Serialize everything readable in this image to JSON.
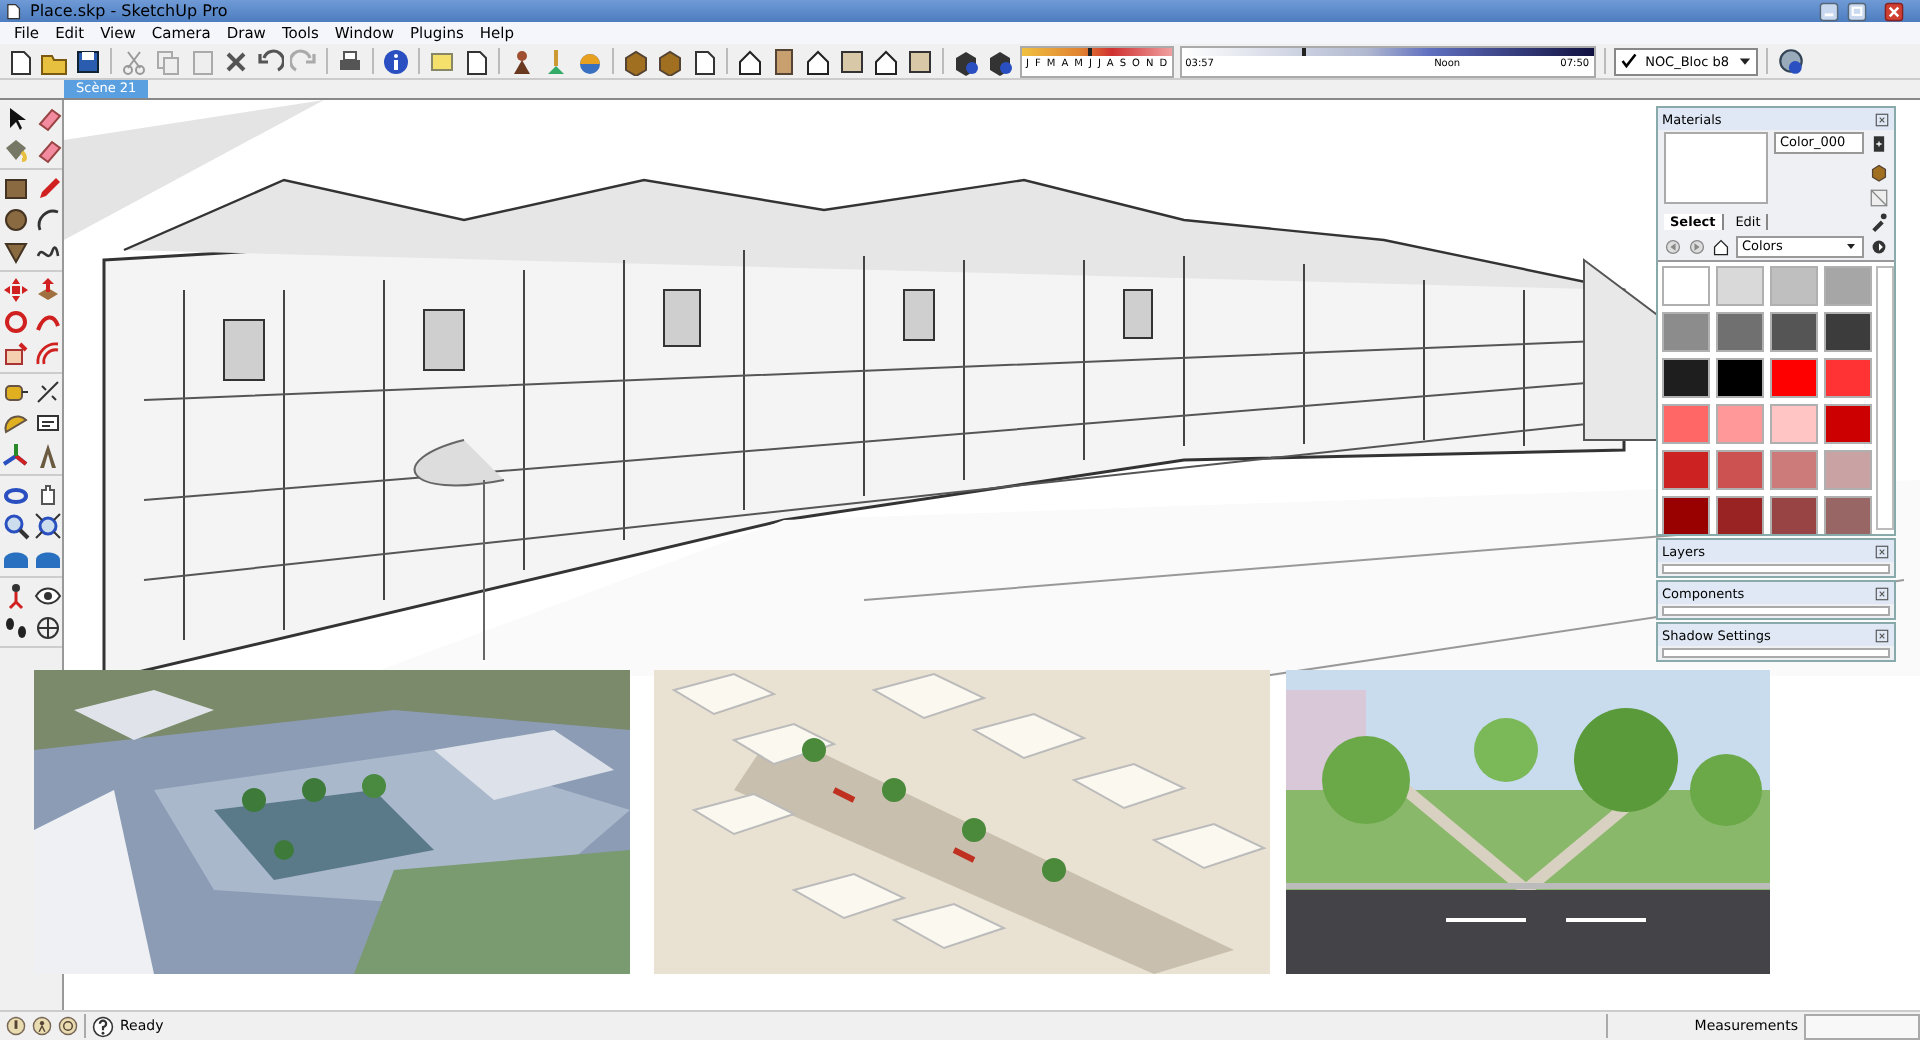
{
  "window": {
    "title": "Place.skp - SketchUp Pro"
  },
  "menu": [
    "File",
    "Edit",
    "View",
    "Camera",
    "Draw",
    "Tools",
    "Window",
    "Plugins",
    "Help"
  ],
  "shadow_toolbar": {
    "date_slider": {
      "level": 0.45
    },
    "time_slider": {
      "level": 0.3
    },
    "months": [
      "J",
      "F",
      "M",
      "A",
      "M",
      "J",
      "J",
      "A",
      "S",
      "O",
      "N",
      "D"
    ],
    "time_start": "03:57",
    "time_noon": "Noon",
    "time_end": "07:50"
  },
  "section_dropdown": {
    "checked": true,
    "value": "NOC_Bloc b8"
  },
  "scene_tabs": [
    {
      "label": "Scène 21",
      "selected": true
    }
  ],
  "materials": {
    "title": "Materials",
    "name": "Color_000",
    "tabs": [
      {
        "label": "Select",
        "selected": true
      },
      {
        "label": "Edit",
        "selected": false
      }
    ],
    "library": "Colors",
    "swatches": [
      {
        "color": "#ffffff"
      },
      {
        "color": "#d9d9d9"
      },
      {
        "color": "#bfbfbf"
      },
      {
        "color": "#a6a6a6"
      },
      {
        "color": "#8c8c8c"
      },
      {
        "color": "#707070"
      },
      {
        "color": "#555555"
      },
      {
        "color": "#3c3c3c"
      },
      {
        "color": "#1e1e1e"
      },
      {
        "color": "#000000"
      },
      {
        "color": "#ff0000"
      },
      {
        "color": "#ff3333"
      },
      {
        "color": "#ff6666"
      },
      {
        "color": "#ff9999"
      },
      {
        "color": "#ffc4c4"
      },
      {
        "color": "#cc0000"
      },
      {
        "color": "#cc2222"
      },
      {
        "color": "#cc5252"
      },
      {
        "color": "#cc7a7a"
      },
      {
        "color": "#c9a3a3"
      },
      {
        "color": "#990000"
      },
      {
        "color": "#992222"
      },
      {
        "color": "#994444"
      },
      {
        "color": "#996666"
      }
    ]
  },
  "panels": [
    {
      "title": "Layers"
    },
    {
      "title": "Components"
    },
    {
      "title": "Shadow Settings"
    }
  ],
  "status_bar": {
    "status": "Ready",
    "measurements_label": "Measurements"
  }
}
